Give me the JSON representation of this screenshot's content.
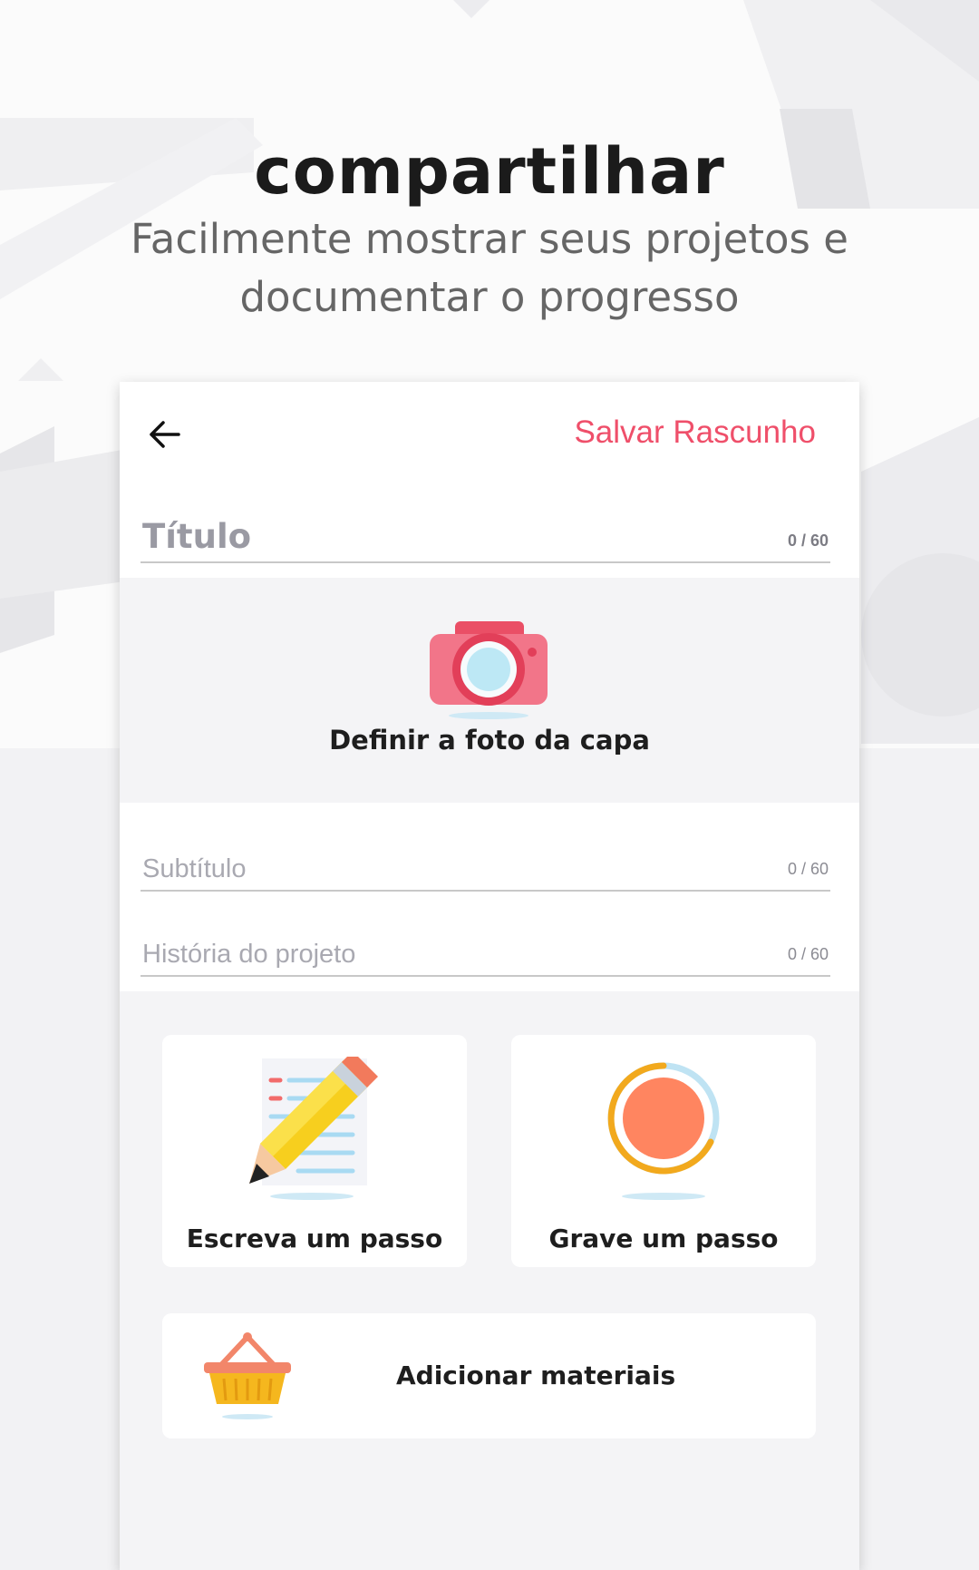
{
  "promo": {
    "headline": "compartilhar",
    "subline_line1": "Facilmente mostrar seus projetos e",
    "subline_line2": "documentar o progresso"
  },
  "toolbar": {
    "back_icon": "arrow-left-icon",
    "save_draft_label": "Salvar Rascunho"
  },
  "form": {
    "title": {
      "placeholder": "Título",
      "counter": "0 / 60"
    },
    "cover": {
      "label": "Definir a foto da capa",
      "icon": "camera-icon"
    },
    "subtitle": {
      "placeholder": "Subtítulo",
      "counter": "0 / 60"
    },
    "story": {
      "placeholder": "História do projeto",
      "counter": "0 / 60"
    }
  },
  "actions": {
    "write_step": {
      "label": "Escreva um passo",
      "icon": "pencil-icon"
    },
    "record_step": {
      "label": "Grave um passo",
      "icon": "record-icon"
    },
    "add_materials": {
      "label": "Adicionar materiais",
      "icon": "basket-icon"
    }
  },
  "colors": {
    "accent": "#ef4f6a",
    "camera": "#f06f85",
    "record": "#ff8560",
    "record_ring": "#f2a91d"
  }
}
